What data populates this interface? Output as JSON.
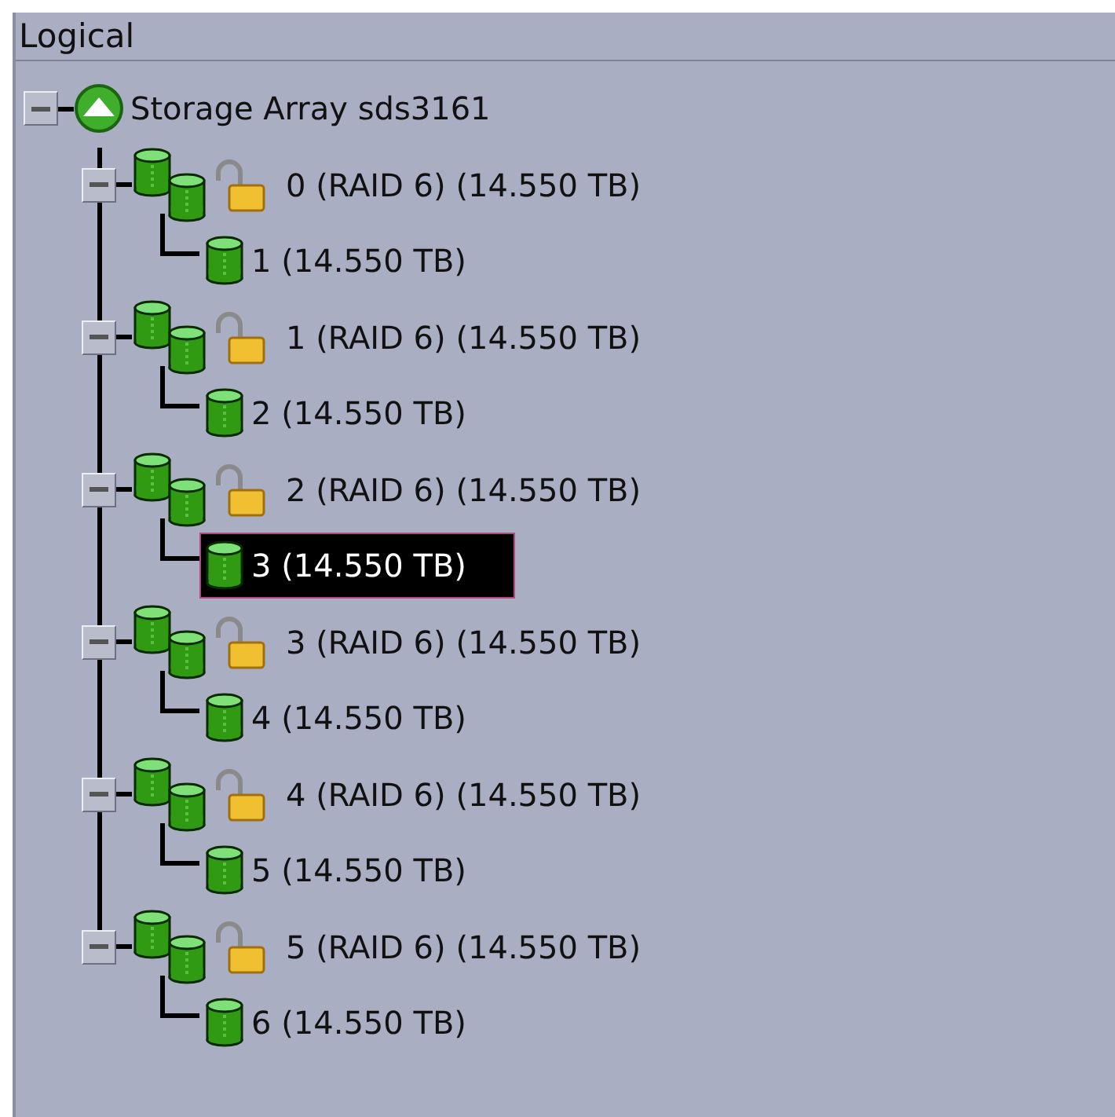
{
  "panel": {
    "title": "Logical"
  },
  "tree": {
    "label": "Storage Array sds3161",
    "expanded": true,
    "children": [
      {
        "label": "0 (RAID 6) (14.550 TB)",
        "expanded": true,
        "locked": false,
        "children": [
          {
            "label": "1 (14.550 TB)",
            "selected": false
          }
        ]
      },
      {
        "label": "1 (RAID 6) (14.550 TB)",
        "expanded": true,
        "locked": false,
        "children": [
          {
            "label": "2 (14.550 TB)",
            "selected": false
          }
        ]
      },
      {
        "label": "2 (RAID 6) (14.550 TB)",
        "expanded": true,
        "locked": false,
        "children": [
          {
            "label": "3 (14.550 TB)",
            "selected": true
          }
        ]
      },
      {
        "label": "3 (RAID 6) (14.550 TB)",
        "expanded": true,
        "locked": false,
        "children": [
          {
            "label": "4 (14.550 TB)",
            "selected": false
          }
        ]
      },
      {
        "label": "4 (RAID 6) (14.550 TB)",
        "expanded": true,
        "locked": false,
        "children": [
          {
            "label": "5 (14.550 TB)",
            "selected": false
          }
        ]
      },
      {
        "label": "5 (RAID 6) (14.550 TB)",
        "expanded": true,
        "locked": false,
        "children": [
          {
            "label": "6 (14.550 TB)",
            "selected": false
          }
        ]
      }
    ]
  }
}
